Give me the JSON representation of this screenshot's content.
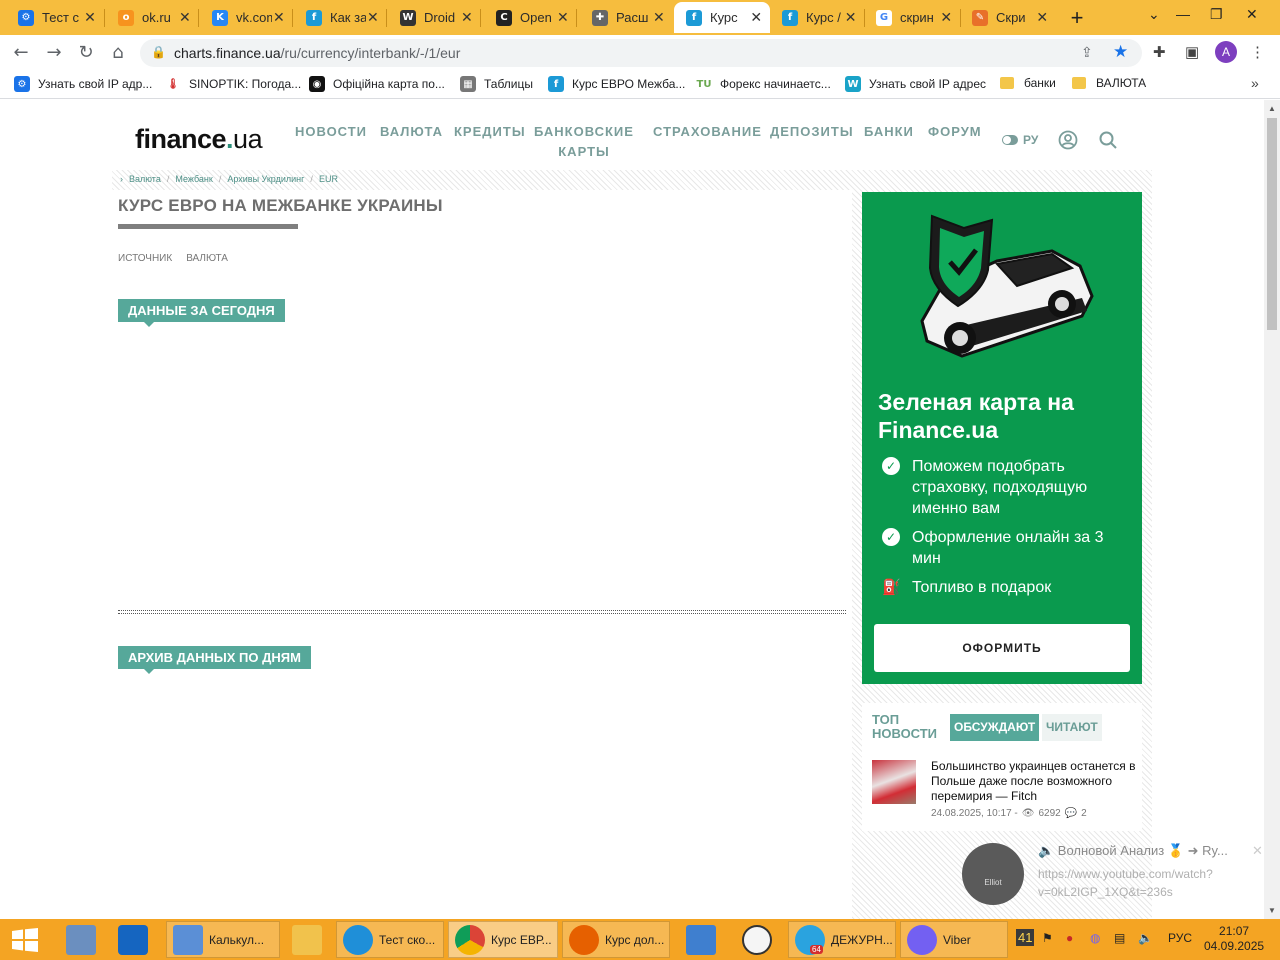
{
  "browser": {
    "tabs": [
      {
        "title": "Тест с",
        "icon_color": "#1a73e8",
        "icon_glyph": "⚙"
      },
      {
        "title": "ok.ru",
        "icon_color": "#f7931e",
        "icon_glyph": "o"
      },
      {
        "title": "vk.com",
        "icon_color": "#2787f5",
        "icon_glyph": "K"
      },
      {
        "title": "Как за",
        "icon_color": "#1c9ad6",
        "icon_glyph": "f"
      },
      {
        "title": "Droid",
        "icon_color": "#333333",
        "icon_glyph": "W"
      },
      {
        "title": "Open",
        "icon_color": "#222222",
        "icon_glyph": "C"
      },
      {
        "title": "Расш",
        "icon_color": "#666666",
        "icon_glyph": "✚"
      },
      {
        "title": "Курс",
        "icon_color": "#1c9ad6",
        "icon_glyph": "f"
      },
      {
        "title": "Курс /",
        "icon_color": "#1c9ad6",
        "icon_glyph": "f"
      },
      {
        "title": "скрин",
        "icon_color": "#4285f4",
        "icon_glyph": "G"
      },
      {
        "title": "Скри",
        "icon_color": "#e8702a",
        "icon_glyph": "✎"
      }
    ],
    "active_tab": 7,
    "url_host": "charts.finance.ua",
    "url_path": "/ru/currency/interbank/-/1/eur",
    "profile_initial": "A",
    "bookmarks": [
      {
        "label": "Узнать свой IP адр...",
        "icon_color": "#1a73e8"
      },
      {
        "label": "SINOPTIK: Погода...",
        "icon_color": "#d32f2f"
      },
      {
        "label": "Офіційна карта по...",
        "icon_color": "#111111"
      },
      {
        "label": "Таблицы",
        "icon_color": "#777777"
      },
      {
        "label": "Курс ЕВРО Межба...",
        "icon_color": "#1c9ad6"
      },
      {
        "label": "Форекс начинаетс...",
        "icon_color": "#6aa84f"
      },
      {
        "label": "Узнать свой IP адрес",
        "icon_color": "#1aa3c8"
      },
      {
        "label": "банки",
        "folder": true
      },
      {
        "label": "ВАЛЮТА",
        "folder": true
      }
    ]
  },
  "site": {
    "logo_main": "finance",
    "logo_dot": ".",
    "logo_suffix": "ua",
    "nav": [
      "НОВОСТИ",
      "ВАЛЮТА",
      "КРЕДИТЫ",
      "БАНКОВСКИЕ КАРТЫ",
      "СТРАХОВАНИЕ",
      "ДЕПОЗИТЫ",
      "БАНКИ",
      "ФОРУМ"
    ],
    "lang": "РУ",
    "breadcrumbs": [
      "Валюта",
      "Межбанк",
      "Архивы Укрдилинг",
      "EUR"
    ],
    "page_title": "КУРС ЕВРО НА МЕЖБАНКЕ УКРАИНЫ",
    "filters": [
      "ИСТОЧНИК",
      "ВАЛЮТА"
    ],
    "section_today": "ДАННЫЕ ЗА СЕГОДНЯ",
    "section_archive": "АРХИВ ДАННЫХ ПО ДНЯМ"
  },
  "ad": {
    "title": "Зеленая карта на Finance.ua",
    "items": [
      "Поможем подобрать страховку, подходящую именно вам",
      "Оформление онлайн за 3 мин",
      "Топливо в подарок"
    ],
    "button": "ОФОРМИТЬ",
    "bg_color": "#0a9a4e"
  },
  "news": {
    "heading": "ТОП НОВОСТИ",
    "tabs": [
      "ОБСУЖДАЮТ",
      "ЧИТАЮТ"
    ],
    "active_tab": 0,
    "item_title": "Большинство украинцев останется в Польше даже после возможного перемирия — Fitch",
    "item_date": "24.08.2025, 10:17 -",
    "item_views": "6292",
    "item_comments": "2"
  },
  "notification": {
    "title": "🔈 Волновой Анализ 🥇 ➜ Ry...",
    "url": "https://www.youtube.com/watch?v=0kL2IGP_1XQ&t=236s",
    "icon_label": "Elliot"
  },
  "taskbar": {
    "items": [
      {
        "label": "Калькул...",
        "icon_color": "#5b8fd6"
      },
      {
        "label": "Тест ско...",
        "icon_color": "#1f8fd8"
      },
      {
        "label": "Курс ЕВР...",
        "icon_color": "#db4437",
        "active": true
      },
      {
        "label": "Курс дол...",
        "icon_color": "#e66000"
      },
      {
        "label": "ДЕЖУРН...",
        "icon_color": "#2aa3df"
      },
      {
        "label": "Viber",
        "icon_color": "#7360f2"
      }
    ],
    "telegram_badge": "64",
    "tray_number": "41",
    "lang": "РУС",
    "time": "21:07",
    "date": "04.09.2025"
  }
}
